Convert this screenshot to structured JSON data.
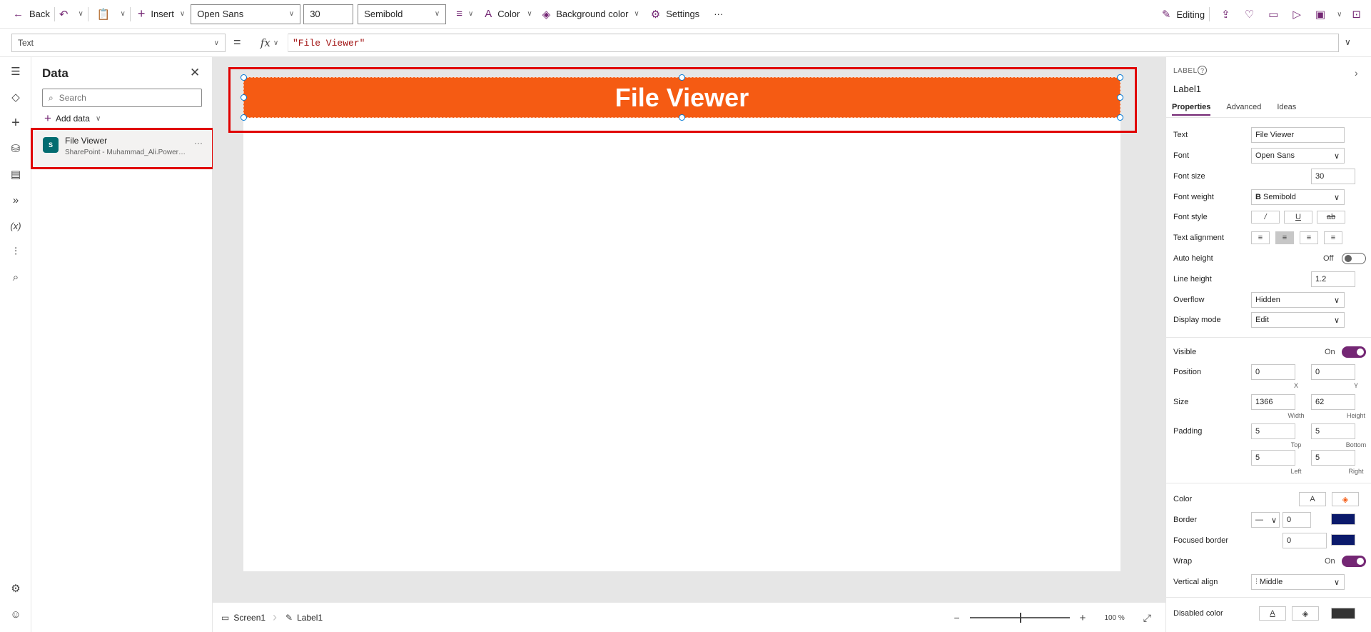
{
  "toolbar": {
    "back_label": "Back",
    "insert_label": "Insert",
    "font_value": "Open Sans",
    "font_size_value": "30",
    "font_weight_value": "Semibold",
    "color_label": "Color",
    "background_color_label": "Background color",
    "settings_label": "Settings",
    "more_label": "···",
    "editing_label": "Editing"
  },
  "formula_bar": {
    "property": "Text",
    "equals": "=",
    "fx": "fx",
    "formula": "\"File Viewer\""
  },
  "data_panel": {
    "title": "Data",
    "search_placeholder": "Search",
    "add_data_label": "Add data",
    "sources": [
      {
        "name": "File Viewer",
        "subtitle": "SharePoint - Muhammad_Ali.PowerApp...",
        "more": "···",
        "logo": "S"
      }
    ]
  },
  "canvas": {
    "label_text": "File Viewer",
    "label_bg": "#f55b13"
  },
  "status_bar": {
    "screen_label": "Screen1",
    "label_label": "Label1",
    "zoom_minus": "−",
    "zoom_plus": "+",
    "zoom_value": "100 %"
  },
  "properties": {
    "type_label": "LABEL",
    "control_name": "Label1",
    "tabs": [
      "Properties",
      "Advanced",
      "Ideas"
    ],
    "text_label": "Text",
    "text_value": "File Viewer",
    "font_label": "Font",
    "font_value": "Open Sans",
    "font_size_label": "Font size",
    "font_size_value": "30",
    "font_weight_label": "Font weight",
    "font_weight_value": "Semibold",
    "font_weight_prefix": "B",
    "font_style_label": "Font style",
    "text_alignment_label": "Text alignment",
    "auto_height_label": "Auto height",
    "auto_height_state": "Off",
    "line_height_label": "Line height",
    "line_height_value": "1.2",
    "overflow_label": "Overflow",
    "overflow_value": "Hidden",
    "display_mode_label": "Display mode",
    "display_mode_value": "Edit",
    "visible_label": "Visible",
    "visible_state": "On",
    "position_label": "Position",
    "position_x": "0",
    "position_y": "0",
    "x_caption": "X",
    "y_caption": "Y",
    "size_label": "Size",
    "size_width": "1366",
    "size_height": "62",
    "width_caption": "Width",
    "height_caption": "Height",
    "padding_label": "Padding",
    "padding_top": "5",
    "padding_bottom": "5",
    "padding_left": "5",
    "padding_right": "5",
    "top_caption": "Top",
    "bottom_caption": "Bottom",
    "left_caption": "Left",
    "right_caption": "Right",
    "color_label": "Color",
    "color_letter": "A",
    "border_label": "Border",
    "border_width": "0",
    "focused_border_label": "Focused border",
    "focused_border_width": "0",
    "wrap_label": "Wrap",
    "wrap_state": "On",
    "vertical_align_label": "Vertical align",
    "vertical_align_value": "Middle",
    "disabled_color_label": "Disabled color",
    "accent_color": "#742774",
    "border_color": "#0b1a6b"
  }
}
